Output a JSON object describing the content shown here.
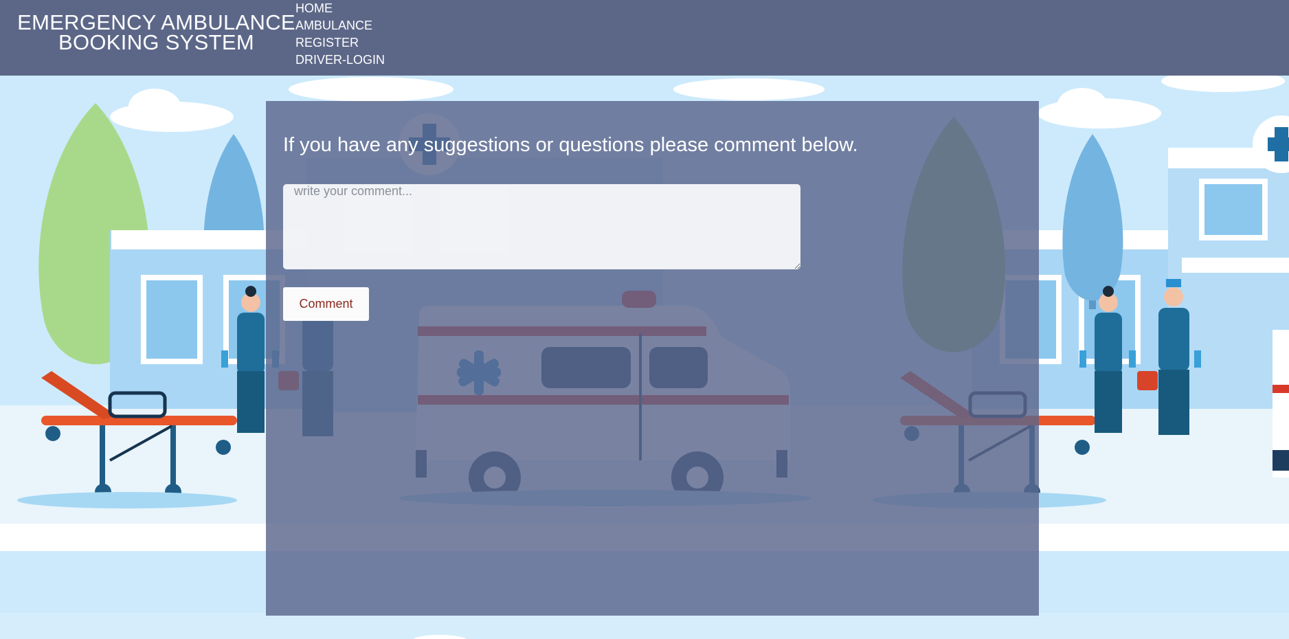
{
  "header": {
    "brand_line1": "EMERGENCY AMBULANCE",
    "brand_line2": "BOOKING SYSTEM",
    "nav": [
      "HOME",
      "AMBULANCE",
      "REGISTER",
      "DRIVER-LOGIN"
    ]
  },
  "main": {
    "prompt": "If you have any suggestions or questions please comment below.",
    "comment_placeholder": "write your comment...",
    "comment_value": "",
    "submit_label": "Comment"
  },
  "colors": {
    "header_bg": "#5c6788",
    "panel_bg": "#5c678c",
    "button_text": "#8b2a1e"
  }
}
